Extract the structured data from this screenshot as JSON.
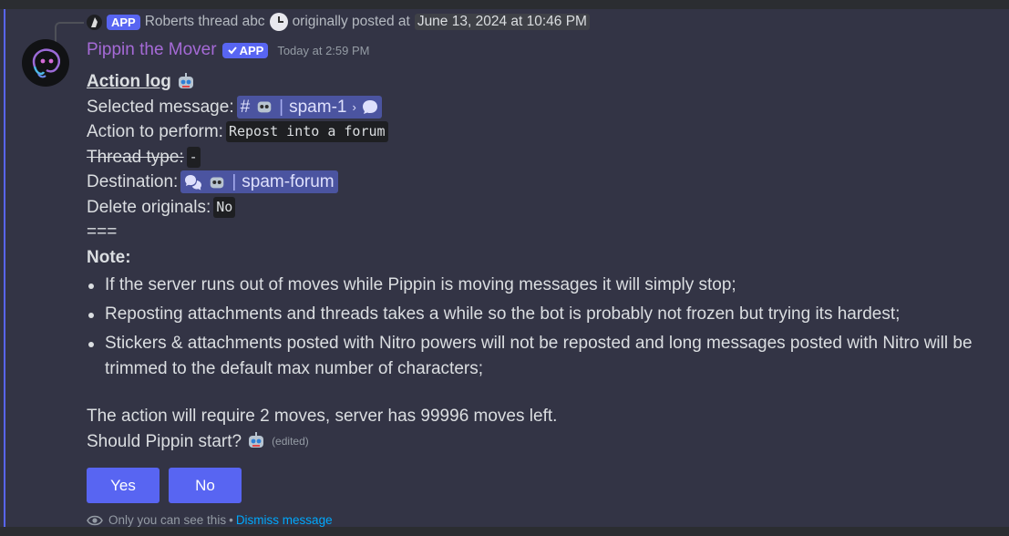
{
  "reply": {
    "app_tag": "APP",
    "author": "Roberts thread abc",
    "posted_prefix": "originally posted at",
    "posted_date": "June 13, 2024 at 10:46 PM"
  },
  "header": {
    "username": "Pippin the Mover",
    "app_tag": "APP",
    "timestamp": "Today at 2:59 PM"
  },
  "content": {
    "title": "Action log",
    "selected_label": "Selected message:",
    "selected_channel": "spam-1",
    "action_label": "Action to perform:",
    "action_value": "Repost into a forum",
    "thread_label": "Thread type:",
    "thread_value": "-",
    "destination_label": "Destination:",
    "destination_channel": "spam-forum",
    "delete_label": "Delete originals:",
    "delete_value": "No",
    "separator": "===",
    "note_label": "Note:",
    "notes": [
      "If the server runs out of moves while Pippin is moving messages it will simply stop;",
      "Reposting attachments and threads takes a while so the bot is probably not frozen but trying its hardest;",
      "Stickers & attachments posted with Nitro powers will not be reposted and long messages posted with Nitro will be trimmed to the default max number of characters;"
    ],
    "moves_text": "The action will require 2 moves, server has 99996 moves left.",
    "question": "Should Pippin start?",
    "edited": "(edited)"
  },
  "buttons": {
    "yes": "Yes",
    "no": "No"
  },
  "footer": {
    "only_you": "Only you can see this",
    "bullet": "•",
    "dismiss": "Dismiss message"
  },
  "colors": {
    "accent": "#5865f2",
    "username": "#a56ad6",
    "link": "#00a8fc",
    "background": "#333445"
  }
}
